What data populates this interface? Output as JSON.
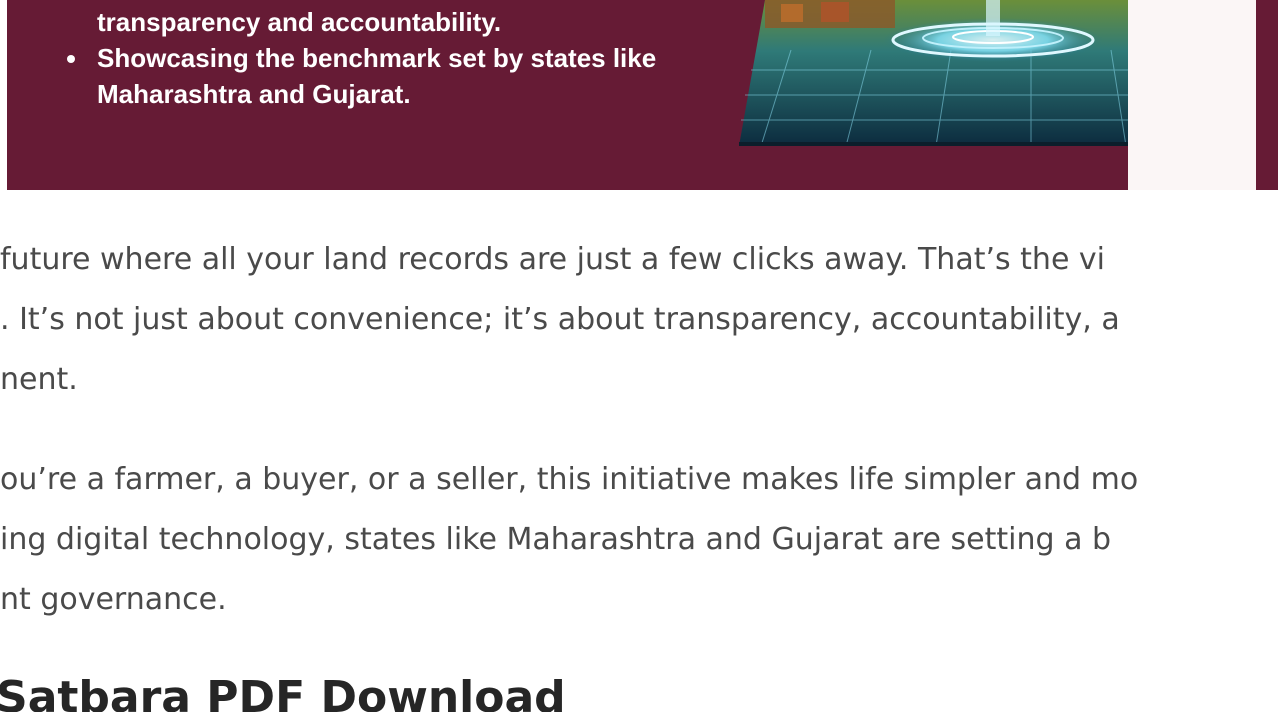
{
  "banner": {
    "bullets": [
      {
        "text": "transparency and accountability.",
        "continuation": true
      },
      {
        "text": "Showcasing the benchmark set by states like",
        "continuation": false
      },
      {
        "text": "Maharashtra and Gujarat.",
        "continuation": true
      }
    ],
    "colors": {
      "background": "#661b35",
      "text": "#ffffff"
    }
  },
  "article": {
    "paragraph_1": [
      "future where all your land records are just a few clicks away. That’s the vi",
      ". It’s not just about convenience; it’s about transparency, accountability, a",
      "nent."
    ],
    "paragraph_2": [
      "ou’re a farmer, a buyer, or a seller, this initiative makes life simpler and mo",
      "ing digital technology, states like Maharashtra and Gujarat are setting a b",
      "nt governance."
    ],
    "heading": "Satbara PDF Download",
    "text_color": "#4a4a4a"
  }
}
